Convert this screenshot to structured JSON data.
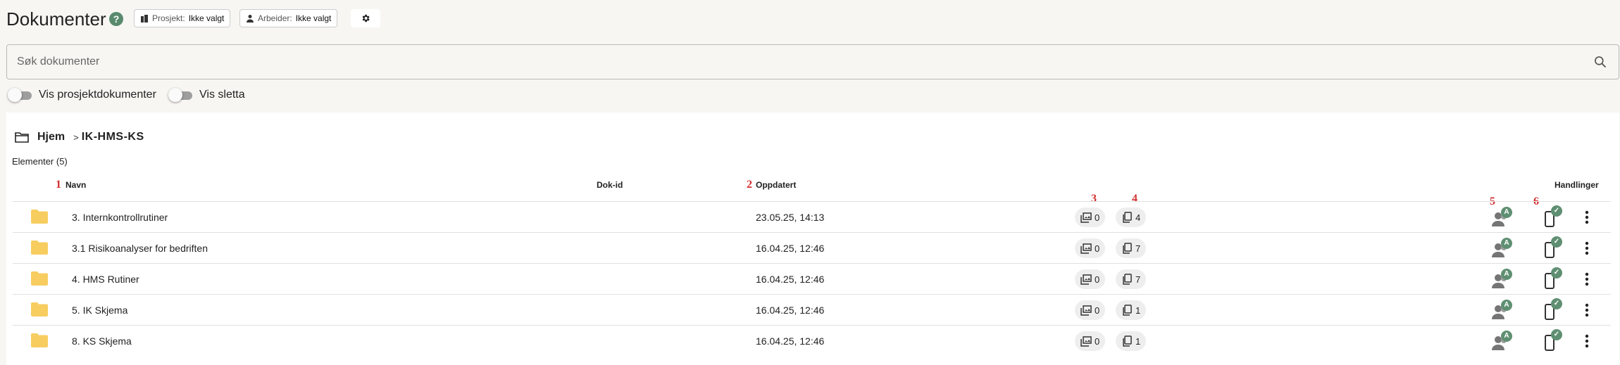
{
  "header": {
    "title": "Dokumenter",
    "help": "?",
    "project_label": "Prosjekt:",
    "project_value": "Ikke valgt",
    "worker_label": "Arbeider:",
    "worker_value": "Ikke valgt"
  },
  "search": {
    "placeholder": "Søk dokumenter",
    "value": ""
  },
  "toggles": {
    "project_docs": {
      "label": "Vis prosjektdokumenter",
      "on": false
    },
    "deleted": {
      "label": "Vis sletta",
      "on": false
    }
  },
  "breadcrumb": {
    "home": "Hjem",
    "separator": ">",
    "current": "IK-HMS-KS"
  },
  "elements_count": "Elementer (5)",
  "columns": {
    "name": "Navn",
    "doc_id": "Dok-id",
    "updated": "Oppdatert",
    "actions": "Handlinger"
  },
  "annotations": [
    "1",
    "2",
    "3",
    "4",
    "5",
    "6"
  ],
  "rows": [
    {
      "name": "3. Internkontrollrutiner",
      "doc_id": "",
      "updated": "23.05.25, 14:13",
      "gallery_count": "0",
      "doc_count": "4",
      "user_badge": "A"
    },
    {
      "name": "3.1 Risikoanalyser for bedriften",
      "doc_id": "",
      "updated": "16.04.25, 12:46",
      "gallery_count": "0",
      "doc_count": "7",
      "user_badge": "A"
    },
    {
      "name": "4. HMS Rutiner",
      "doc_id": "",
      "updated": "16.04.25, 12:46",
      "gallery_count": "0",
      "doc_count": "7",
      "user_badge": "A"
    },
    {
      "name": "5. IK Skjema",
      "doc_id": "",
      "updated": "16.04.25, 12:46",
      "gallery_count": "0",
      "doc_count": "1",
      "user_badge": "A"
    },
    {
      "name": "8. KS Skjema",
      "doc_id": "",
      "updated": "16.04.25, 12:46",
      "gallery_count": "0",
      "doc_count": "1",
      "user_badge": "A"
    }
  ],
  "colors": {
    "folder": "#f7cd60",
    "accent_green": "#5f8f72",
    "annotation_red": "#d32f2f"
  },
  "icons": {
    "help": "help-circle-icon",
    "project": "building-icon",
    "worker": "person-icon",
    "settings": "gear-icon",
    "search": "search-icon",
    "breadcrumb": "folder-outline-icon",
    "row_type": "folder-icon",
    "gallery": "gallery-icon",
    "documents": "documents-icon",
    "users": "users-access-icon",
    "mobile": "mobile-check-icon",
    "more": "more-vertical-icon"
  }
}
